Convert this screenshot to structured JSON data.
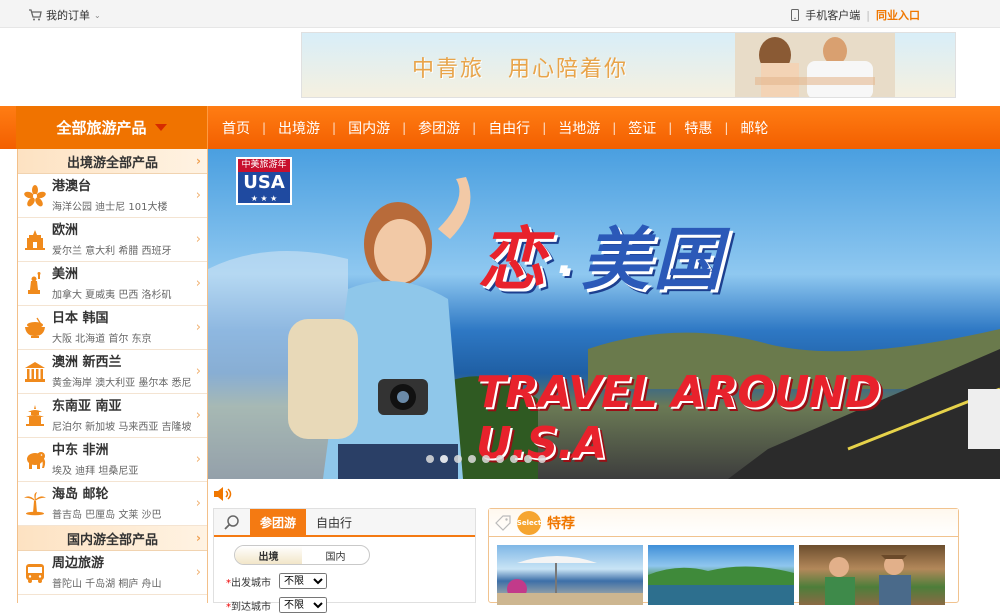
{
  "topbar": {
    "my_orders": "我的订单",
    "mobile_client": "手机客户端",
    "peer_entry": "同业入口"
  },
  "ad_banner": {
    "brand": "中青旅",
    "slogan": "用心陪着你"
  },
  "nav": {
    "all_products": "全部旅游产品",
    "items": [
      "首页",
      "出境游",
      "国内游",
      "参团游",
      "自由行",
      "当地游",
      "签证",
      "特惠",
      "邮轮"
    ]
  },
  "sidebar": {
    "outbound_head": "出境游全部产品",
    "domestic_head": "国内游全部产品",
    "items": [
      {
        "title": "港澳台",
        "sub": "海洋公园 迪士尼 101大楼",
        "icon": "bauhinia-icon"
      },
      {
        "title": "欧洲",
        "sub": "爱尔兰 意大利 希腊 西班牙",
        "icon": "palace-icon"
      },
      {
        "title": "美洲",
        "sub": "加拿大 夏威夷 巴西 洛杉矶",
        "icon": "statue-of-liberty-icon"
      },
      {
        "title": "日本 韩国",
        "sub": "大阪 北海道 首尔 东京",
        "icon": "bowl-icon"
      },
      {
        "title": "澳洲 新西兰",
        "sub": "黄金海岸 澳大利亚 墨尔本 悉尼",
        "icon": "temple-icon"
      },
      {
        "title": "东南亚 南亚",
        "sub": "尼泊尔 新加坡 马来西亚 吉隆坡",
        "icon": "pagoda-icon"
      },
      {
        "title": "中东 非洲",
        "sub": "埃及 迪拜 坦桑尼亚",
        "icon": "elephant-icon"
      },
      {
        "title": "海岛 邮轮",
        "sub": "普吉岛 巴厘岛 文莱 沙巴",
        "icon": "palm-tree-icon"
      }
    ],
    "domestic_items": [
      {
        "title": "周边旅游",
        "sub": "普陀山 千岛湖 桐庐 舟山",
        "icon": "bus-icon"
      }
    ]
  },
  "hero": {
    "badge_top": "中美旅游年",
    "badge_main": "USA",
    "badge_stars": "★ ★ ★",
    "title_love": "恋",
    "title_dot": "·",
    "title_usa": "美国",
    "subtitle": "TRAVEL AROUND U.S.A",
    "slide_count": 9,
    "active_slide": 1
  },
  "search": {
    "tabs": [
      "参团游",
      "自由行"
    ],
    "active_tab": "参团游",
    "toggle": [
      "出境",
      "国内"
    ],
    "active_toggle": "出境",
    "fields": [
      {
        "label": "出发城市",
        "value": "不限"
      },
      {
        "label": "到达城市",
        "value": "不限"
      }
    ]
  },
  "special": {
    "badge": "Select",
    "title": "特荐"
  },
  "colors": {
    "brand_orange": "#f47a12",
    "nav_orange": "#f35f00",
    "accent_text": "#f07700"
  }
}
